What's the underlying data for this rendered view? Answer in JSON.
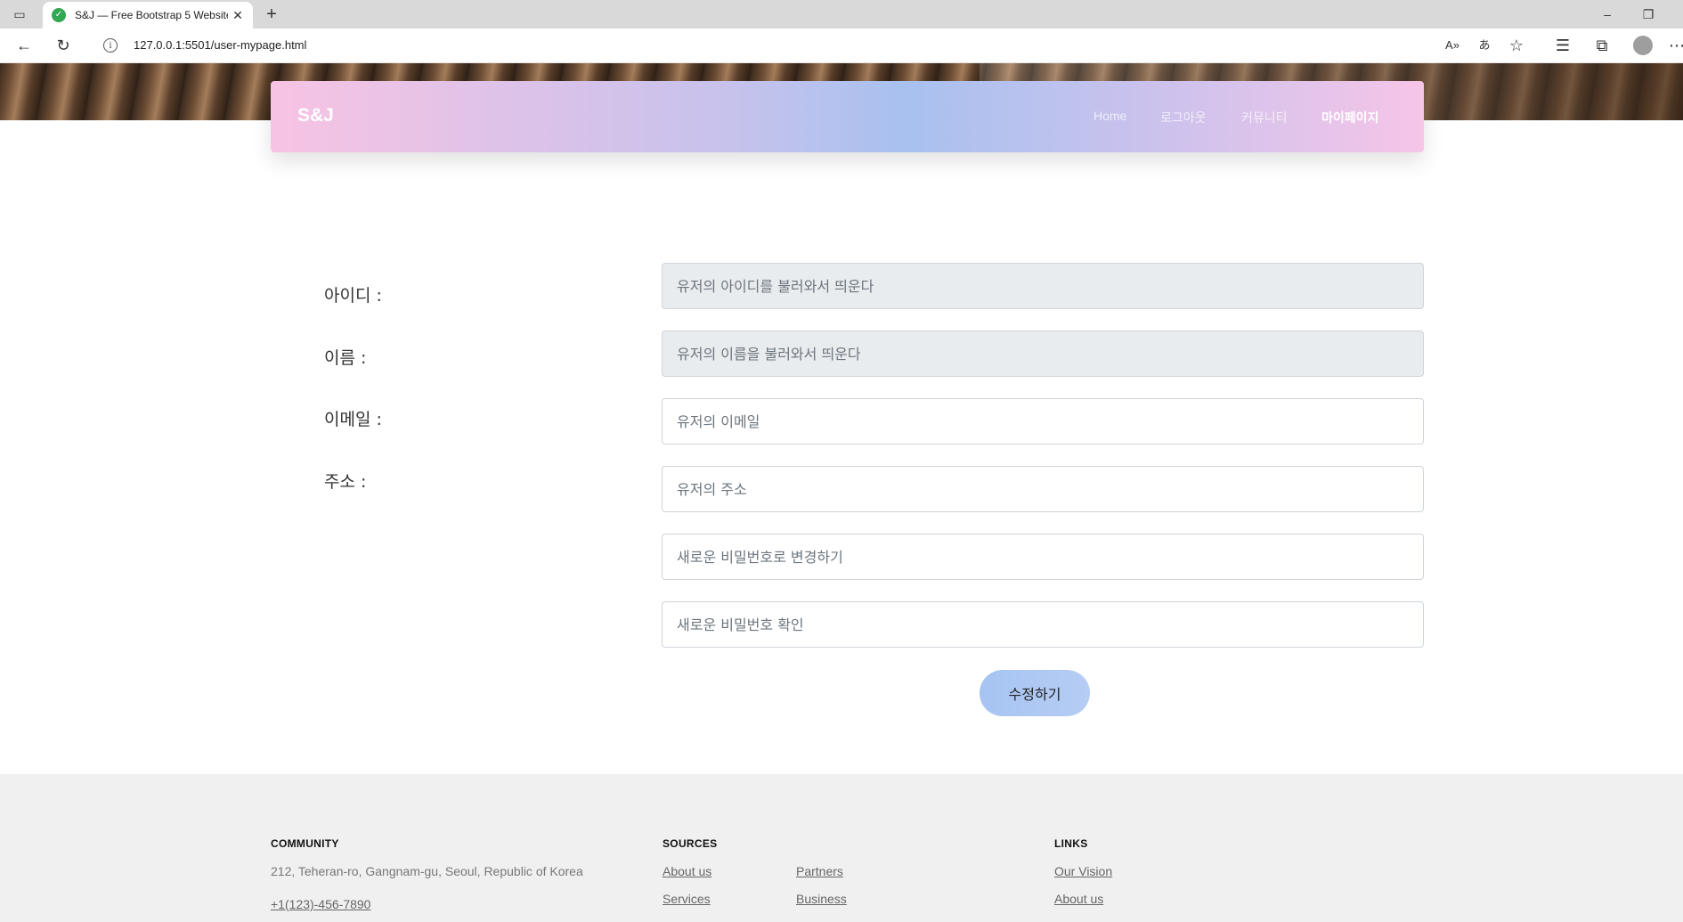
{
  "browser": {
    "tab_title": "S&J — Free Bootstrap 5 Website",
    "url": "127.0.0.1:5501/user-mypage.html"
  },
  "navbar": {
    "brand": "S&J",
    "links": [
      {
        "label": "Home"
      },
      {
        "label": "로그아웃"
      },
      {
        "label": "커뮤니티"
      },
      {
        "label": "마이페이지",
        "active": true
      }
    ]
  },
  "form": {
    "labels": {
      "id": "아이디 :",
      "name": "이름 :",
      "email": "이메일 :",
      "address": "주소 :"
    },
    "placeholders": {
      "id": "유저의 아이디를 불러와서 띄운다",
      "name": "유저의 이름을 불러와서 띄운다",
      "email": "유저의 이메일",
      "address": "유저의 주소",
      "new_password": "새로운 비밀번호로 변경하기",
      "confirm_password": "새로운 비밀번호 확인"
    },
    "submit_label": "수정하기"
  },
  "footer": {
    "community": {
      "heading": "COMMUNITY",
      "address": "212, Teheran-ro, Gangnam-gu, Seoul, Republic of Korea",
      "phone": "+1(123)-456-7890"
    },
    "sources": {
      "heading": "SOURCES",
      "links": [
        "About us",
        "Services",
        "Partners",
        "Business"
      ]
    },
    "links": {
      "heading": "LINKS",
      "items": [
        "Our Vision",
        "About us"
      ]
    }
  },
  "colors": {
    "navbar_gradient": [
      "#f7c3e4",
      "#a8c1ef",
      "#f6c5e8"
    ],
    "button": "#a6c4f2",
    "footer_bg": "#f0f0f0"
  }
}
